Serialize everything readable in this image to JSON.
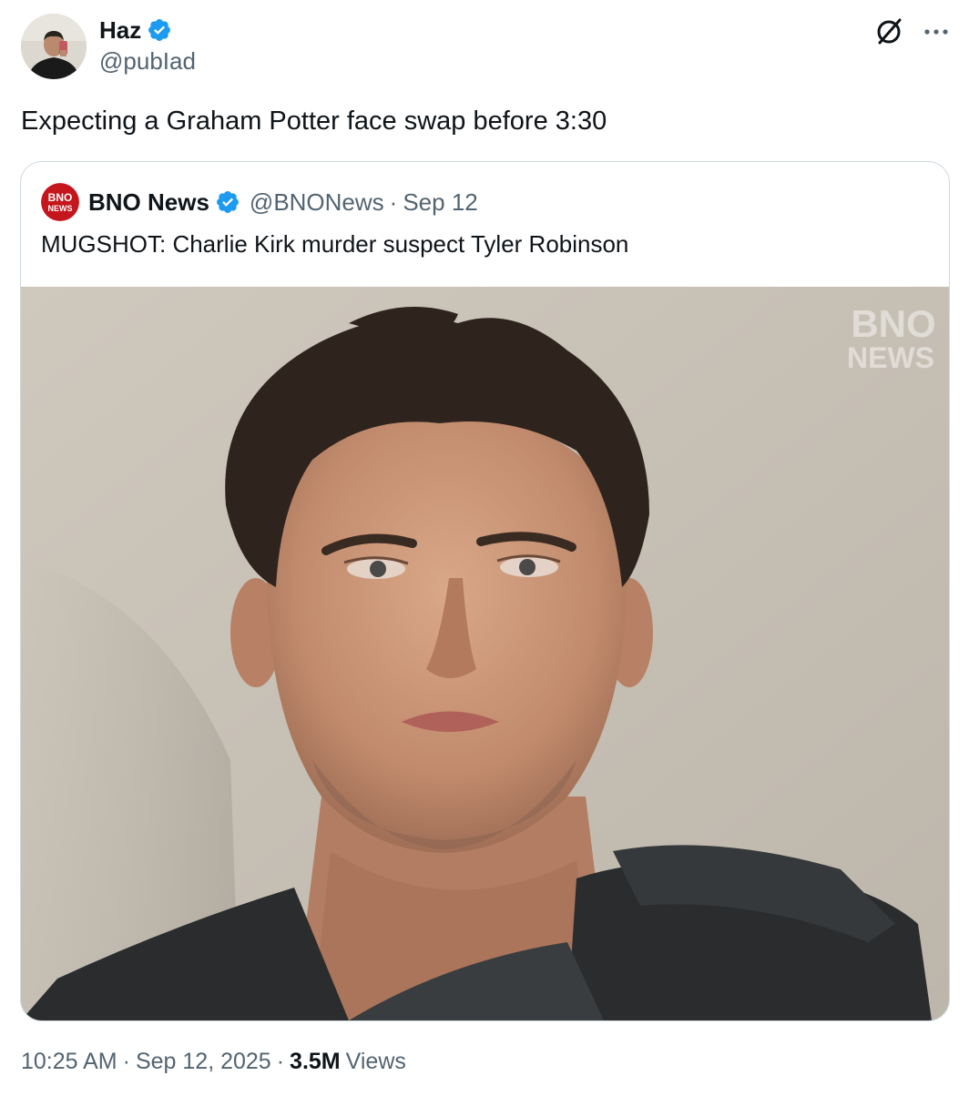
{
  "tweet": {
    "author_name": "Haz",
    "author_handle": "@pubIad",
    "verified_icon": "verified-badge-icon",
    "text": "Expecting a Graham Potter face swap before 3:30",
    "time": "10:25 AM",
    "separator": "·",
    "date": "Sep 12, 2025",
    "views_count": "3.5M",
    "views_label": "Views"
  },
  "actions": {
    "grok_icon": "grok-icon",
    "more_icon": "more-icon"
  },
  "quote": {
    "avatar_line1": "BNO",
    "avatar_line2": "NEWS",
    "name": "BNO News",
    "handle": "@BNONews",
    "separator": "·",
    "date": "Sep 12",
    "text": "MUGSHOT: Charlie Kirk murder suspect Tyler Robinson",
    "media": {
      "watermark_line1": "BNO",
      "watermark_line2": "NEWS"
    }
  },
  "colors": {
    "text_primary": "#0f1419",
    "text_secondary": "#536471",
    "verified_blue": "#1d9bf0",
    "border": "#cfd9de",
    "bno_red": "#c4161c"
  }
}
